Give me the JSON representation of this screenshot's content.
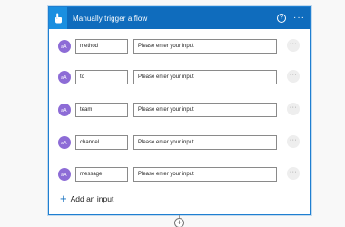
{
  "header": {
    "title": "Manually trigger a flow",
    "trigger_icon": "hand-pointer-icon",
    "help_icon": "question-circle-icon",
    "help_glyph": "?",
    "more_icon": "ellipsis-icon",
    "more_glyph": "···"
  },
  "inputs": [
    {
      "name": "method",
      "placeholder": "Please enter your input"
    },
    {
      "name": "to",
      "placeholder": "Please enter your input"
    },
    {
      "name": "team",
      "placeholder": "Please enter your input"
    },
    {
      "name": "channel",
      "placeholder": "Please enter your input"
    },
    {
      "name": "message",
      "placeholder": "Please enter your input"
    }
  ],
  "row_more_glyph": "···",
  "add_input": {
    "plus": "+",
    "label": "Add an input"
  },
  "connector": {
    "plus": "+"
  },
  "colors": {
    "header": "#0f6cbd",
    "trigger_tile": "#1a8fe0",
    "param_icon": "#8d6cd6",
    "accent_plus": "#0f6cbd"
  }
}
